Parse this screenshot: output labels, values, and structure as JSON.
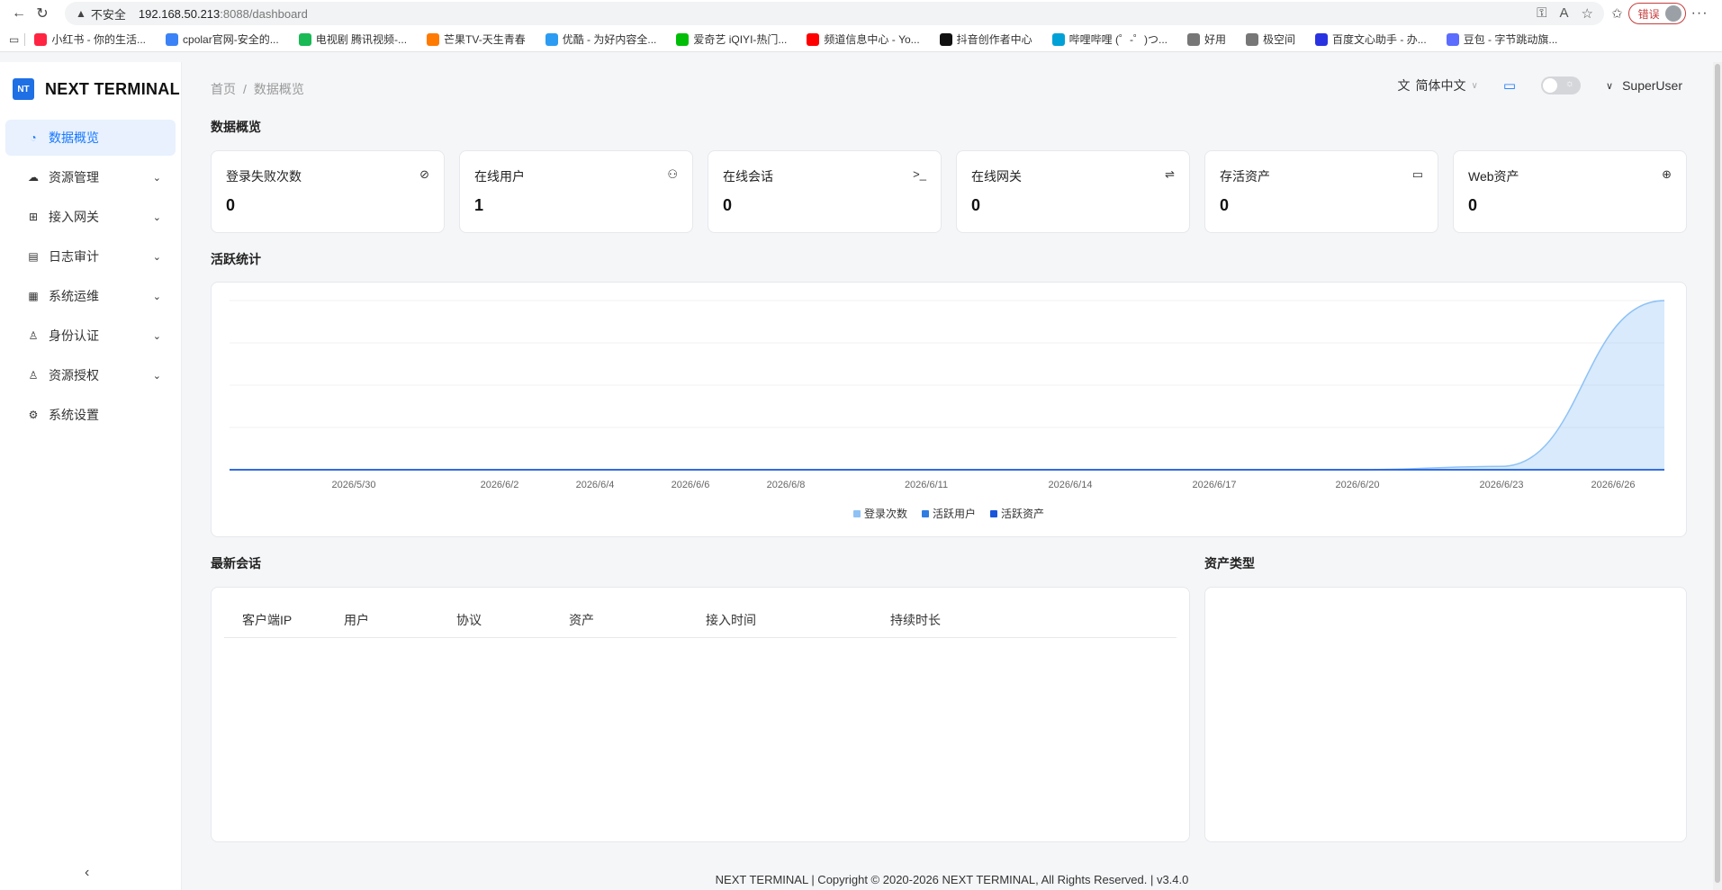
{
  "browser": {
    "insecure_label": "不安全",
    "url_host": "192.168.50.213",
    "url_path": ":8088/dashboard",
    "error_label": "错误",
    "bookmarks": [
      {
        "label": "小红书 - 你的生活...",
        "color": "#ff2442"
      },
      {
        "label": "cpolar官网-安全的...",
        "color": "#3b82f6"
      },
      {
        "label": "电视剧 腾讯视频-...",
        "color": "#19b955"
      },
      {
        "label": "芒果TV-天生青春",
        "color": "#ff7a00"
      },
      {
        "label": "优酷 - 为好内容全...",
        "color": "#2b9cf2"
      },
      {
        "label": "爱奇艺 iQIYI-热门...",
        "color": "#00be06"
      },
      {
        "label": "频道信息中心 - Yo...",
        "color": "#ff0000"
      },
      {
        "label": "抖音创作者中心",
        "color": "#111111"
      },
      {
        "label": "哔哩哔哩 (゜-゜)つ...",
        "color": "#00a1d6"
      },
      {
        "label": "好用",
        "color": "#777777"
      },
      {
        "label": "极空间",
        "color": "#777777"
      },
      {
        "label": "百度文心助手 - 办...",
        "color": "#2932e1"
      },
      {
        "label": "豆包 - 字节跳动旗...",
        "color": "#5b6cff"
      }
    ]
  },
  "sidebar": {
    "logo_mark": "NT",
    "logo_text": "NEXT TERMINAL",
    "items": [
      {
        "label": "数据概览",
        "icon": "dashboard-icon",
        "glyph": "◔",
        "active": true,
        "has_children": false
      },
      {
        "label": "资源管理",
        "icon": "cloud-icon",
        "glyph": "☁",
        "active": false,
        "has_children": true
      },
      {
        "label": "接入网关",
        "icon": "gateway-icon",
        "glyph": "⊞",
        "active": false,
        "has_children": true
      },
      {
        "label": "日志审计",
        "icon": "audit-icon",
        "glyph": "▤",
        "active": false,
        "has_children": true
      },
      {
        "label": "系统运维",
        "icon": "ops-icon",
        "glyph": "▦",
        "active": false,
        "has_children": true
      },
      {
        "label": "身份认证",
        "icon": "user-icon",
        "glyph": "♙",
        "active": false,
        "has_children": true
      },
      {
        "label": "资源授权",
        "icon": "auth-icon",
        "glyph": "♙",
        "active": false,
        "has_children": true
      },
      {
        "label": "系统设置",
        "icon": "gear-icon",
        "glyph": "⚙",
        "active": false,
        "has_children": false
      }
    ]
  },
  "header": {
    "breadcrumb_home": "首页",
    "breadcrumb_sep": "/",
    "breadcrumb_current": "数据概览",
    "language": "简体中文",
    "user": "SuperUser"
  },
  "overview": {
    "title": "数据概览",
    "cards": [
      {
        "label": "登录失败次数",
        "value": "0",
        "icon": "shield-off-icon",
        "glyph": "⊘"
      },
      {
        "label": "在线用户",
        "value": "1",
        "icon": "users-icon",
        "glyph": "⚇"
      },
      {
        "label": "在线会话",
        "value": "0",
        "icon": "terminal-icon",
        "glyph": ">_"
      },
      {
        "label": "在线网关",
        "value": "0",
        "icon": "route-icon",
        "glyph": "⇌"
      },
      {
        "label": "存活资产",
        "value": "0",
        "icon": "server-icon",
        "glyph": "▭"
      },
      {
        "label": "Web资产",
        "value": "0",
        "icon": "globe-icon",
        "glyph": "⊕"
      }
    ]
  },
  "activity": {
    "title": "活跃统计"
  },
  "chart_data": {
    "type": "area",
    "x_ticks": [
      "2026/5/30",
      "2026/6/2",
      "2026/6/4",
      "2026/6/6",
      "2026/6/8",
      "2026/6/11",
      "2026/6/14",
      "2026/6/17",
      "2026/6/20",
      "2026/6/23",
      "2026/6/26"
    ],
    "series": [
      {
        "name": "登录次数",
        "color": "#8ec2f5",
        "values": [
          0,
          0,
          0,
          0,
          0,
          0,
          0,
          0,
          0,
          0.08,
          4
        ]
      },
      {
        "name": "活跃用户",
        "color": "#2f7de1",
        "values": [
          0,
          0,
          0,
          0,
          0,
          0,
          0,
          0,
          0,
          0,
          0
        ]
      },
      {
        "name": "活跃资产",
        "color": "#1a56db",
        "values": [
          0,
          0,
          0,
          0,
          0,
          0,
          0,
          0,
          0,
          0,
          0
        ]
      }
    ],
    "ylim": [
      0,
      4
    ],
    "grid": true,
    "legend": "bottom"
  },
  "sessions": {
    "title": "最新会话",
    "columns": [
      "客户端IP",
      "用户",
      "协议",
      "资产",
      "接入时间",
      "持续时长"
    ]
  },
  "asset_types": {
    "title": "资产类型"
  },
  "footer": {
    "text": "NEXT TERMINAL | Copyright © 2020-2026 NEXT TERMINAL, All Rights Reserved. | v3.4.0"
  }
}
